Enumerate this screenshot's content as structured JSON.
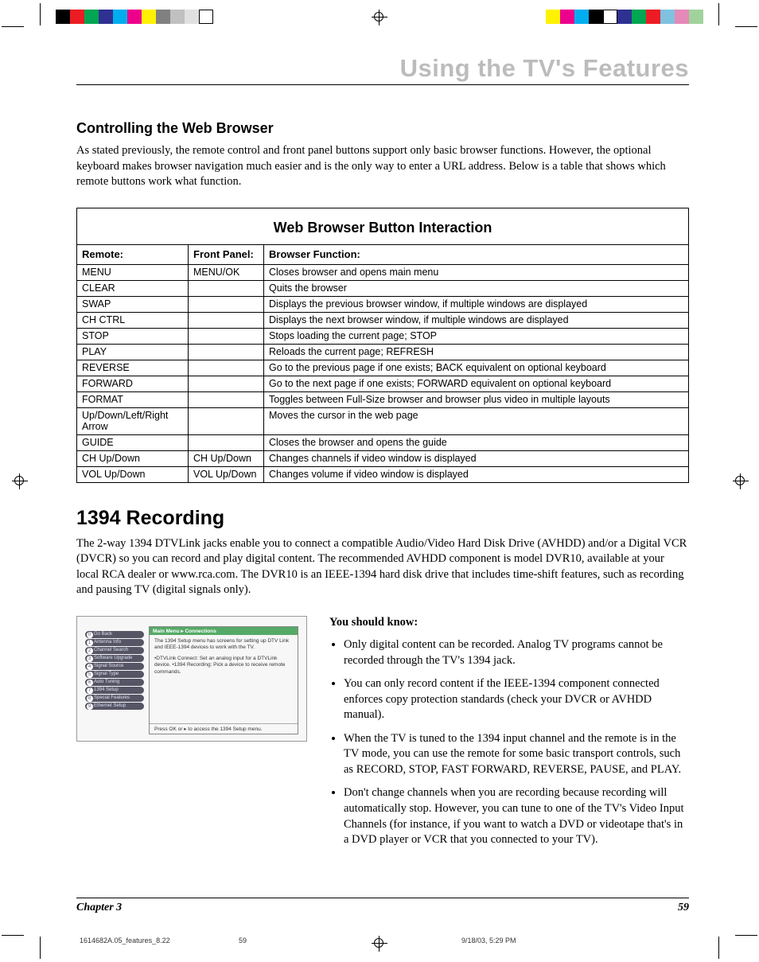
{
  "printmarks": {
    "left_swatches": [
      "#000000",
      "#ed1c24",
      "#00a651",
      "#2e3192",
      "#00aeef",
      "#ec008c",
      "#fff200",
      "#808080",
      "#c0c0c0",
      "#e0e0e0",
      "#ffffff"
    ],
    "right_swatches": [
      "#fff200",
      "#ec008c",
      "#00aeef",
      "#000000",
      "#ffffff",
      "#2e3192",
      "#00a651",
      "#ed1c24",
      "#7fc2e0",
      "#e589b8",
      "#a0d39c"
    ]
  },
  "chapter_heading": "Using the TV's Features",
  "section1_title": "Controlling the Web Browser",
  "section1_body": "As stated previously, the remote control and front panel buttons support only basic browser functions. However, the optional keyboard makes browser navigation much easier and is the only way to enter a URL address. Below is a table that shows which remote buttons work what function.",
  "table": {
    "title": "Web Browser Button Interaction",
    "headers": [
      "Remote:",
      "Front Panel:",
      "Browser Function:"
    ],
    "rows": [
      [
        "MENU",
        "MENU/OK",
        "Closes browser and opens main menu"
      ],
      [
        "CLEAR",
        "",
        "Quits the browser"
      ],
      [
        "SWAP",
        "",
        "Displays the previous browser window, if multiple windows are displayed"
      ],
      [
        "CH CTRL",
        "",
        "Displays the next browser window, if multiple windows are displayed"
      ],
      [
        "STOP",
        "",
        "Stops loading the current page; STOP"
      ],
      [
        "PLAY",
        "",
        "Reloads the current page; REFRESH"
      ],
      [
        "REVERSE",
        "",
        "Go to the previous page if one exists; BACK equivalent on optional keyboard"
      ],
      [
        "FORWARD",
        "",
        "Go to the next page if one exists; FORWARD equivalent on optional keyboard"
      ],
      [
        "FORMAT",
        "",
        "Toggles between Full-Size browser and browser plus video in multiple layouts"
      ],
      [
        "Up/Down/Left/Right Arrow",
        "",
        "Moves the cursor in the web page"
      ],
      [
        "GUIDE",
        "",
        "Closes the browser and opens the guide"
      ],
      [
        "CH Up/Down",
        "CH Up/Down",
        "Changes channels if video window is displayed"
      ],
      [
        "VOL Up/Down",
        "VOL Up/Down",
        "Changes volume if video window is displayed"
      ]
    ]
  },
  "section2_title": "1394 Recording",
  "section2_body": "The 2-way 1394 DTVLink jacks enable you to connect a compatible Audio/Video Hard Disk Drive (AVHDD) and/or a Digital VCR (DVCR) so you can record and play digital content. The recommended AVHDD component is model DVR10, available at your local RCA dealer or www.rca.com. The DVR10 is an IEEE-1394 hard disk drive that includes time-shift features, such as recording and pausing TV (digital signals only).",
  "menu_screenshot": {
    "breadcrumb": "Main Menu ▸ Connections",
    "items": [
      {
        "num": "0",
        "label": "Go Back"
      },
      {
        "num": "1",
        "label": "Antenna Info"
      },
      {
        "num": "2",
        "label": "Channel Search"
      },
      {
        "num": "3",
        "label": "Software Upgrade"
      },
      {
        "num": "4",
        "label": "Signal Source"
      },
      {
        "num": "5",
        "label": "Signal Type"
      },
      {
        "num": "6",
        "label": "Auto Tuning"
      },
      {
        "num": "7",
        "label": "1394 Setup"
      },
      {
        "num": "8",
        "label": "Special Features"
      },
      {
        "num": "9",
        "label": "Ethernet Setup"
      }
    ],
    "desc1": "The 1394 Setup menu has screens for setting up DTV Link and IEEE-1394 devices to work with the TV.",
    "desc2": "•DTVLink Connect: Set an analog input for a DTVLink device. •1394 Recording: Pick a device to receive remote commands.",
    "hint": "Press OK or ▸ to access the 1394 Setup menu."
  },
  "know_heading": "You should know:",
  "know_items": [
    "Only digital content can be recorded. Analog TV programs cannot be recorded through the TV's 1394 jack.",
    "You can only record content if the IEEE-1394 component connected enforces copy protection standards (check your DVCR or AVHDD manual).",
    "When the TV is tuned to the 1394 input channel and the remote is in the TV mode, you can use the remote for some basic transport controls, such as RECORD, STOP, FAST FORWARD, REVERSE, PAUSE, and PLAY.",
    "Don't change channels when you are recording because recording will automatically stop. However, you can tune to one of the TV's Video Input Channels (for instance, if you want to watch a DVD or videotape that's in a DVD player or VCR that you connected to your TV)."
  ],
  "footer": {
    "chapter": "Chapter 3",
    "page": "59"
  },
  "meta": {
    "file": "1614682A.05_features_8.22",
    "pg": "59",
    "datetime": "9/18/03, 5:29 PM"
  }
}
